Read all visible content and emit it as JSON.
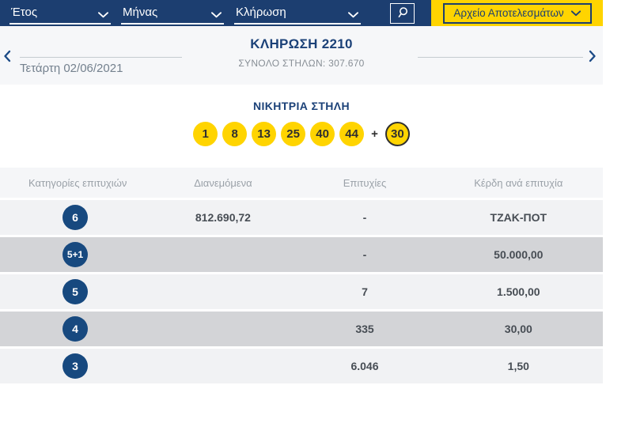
{
  "topbar": {
    "year_label": "Έτος",
    "month_label": "Μήνας",
    "draw_label": "Κλήρωση",
    "archive_label": "Αρχείο Αποτελεσμάτων"
  },
  "draw_nav": {
    "date": "Τετάρτη 02/06/2021",
    "title": "ΚΛΗΡΩΣΗ 2210",
    "subtitle": "ΣΥΝΟΛΟ ΣΤΗΛΩΝ: 307.670"
  },
  "winning": {
    "title": "ΝΙΚΗΤΡΙΑ ΣΤΗΛΗ",
    "numbers": [
      "1",
      "8",
      "13",
      "25",
      "40",
      "44"
    ],
    "plus_sign": "+",
    "bonus_number": "30"
  },
  "results_table": {
    "headers": [
      "Κατηγορίες επιτυχιών",
      "Διανεμόμενα",
      "Επιτυχίες",
      "Κέρδη ανά επιτυχία"
    ],
    "rows": [
      {
        "category": "6",
        "distributed": "812.690,72",
        "winners": "-",
        "prize": "ΤΖΑΚ-ΠΟΤ"
      },
      {
        "category": "5+1",
        "distributed": "",
        "winners": "-",
        "prize": "50.000,00"
      },
      {
        "category": "5",
        "distributed": "",
        "winners": "7",
        "prize": "1.500,00"
      },
      {
        "category": "4",
        "distributed": "",
        "winners": "335",
        "prize": "30,00"
      },
      {
        "category": "3",
        "distributed": "",
        "winners": "6.046",
        "prize": "1,50"
      }
    ]
  },
  "colors": {
    "navy": "#1c3e70",
    "yellow": "#ffd400",
    "category_circle": "#17497f",
    "row_light": "#f1f2f4",
    "row_dark": "#d3d4d7"
  }
}
